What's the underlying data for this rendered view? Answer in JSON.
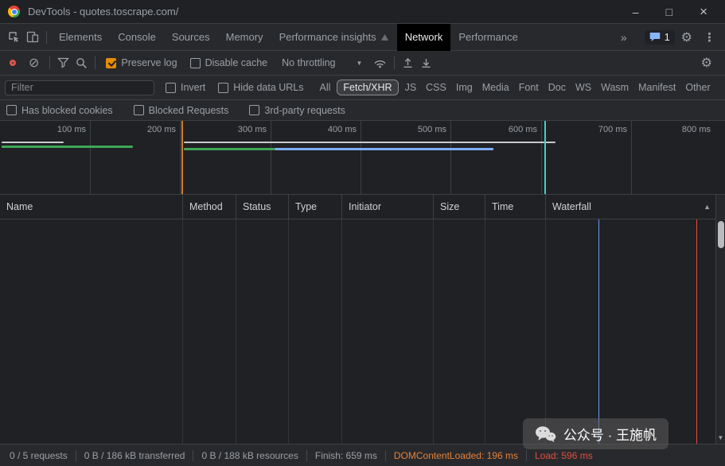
{
  "titlebar": {
    "title": "DevTools - quotes.toscrape.com/"
  },
  "icons": {
    "minimize": "–",
    "maximize": "□",
    "close": "×",
    "overflow": "»",
    "gear": "⚙",
    "more": "⋮",
    "clear": "⊘",
    "caret": "▼",
    "sort_asc": "▲",
    "scroll_down": "▼",
    "wechat": "wechat-bubbles"
  },
  "tabbar": {
    "tabs": [
      "Elements",
      "Console",
      "Sources",
      "Memory",
      "Performance insights",
      "Network",
      "Performance"
    ],
    "active_tab": "Network",
    "issues_count": "1"
  },
  "toolbar": {
    "preserve_log": "Preserve log",
    "disable_cache": "Disable cache",
    "throttling": "No throttling"
  },
  "filters": {
    "placeholder": "Filter",
    "invert": "Invert",
    "hide_data_urls": "Hide data URLs",
    "types": [
      "All",
      "Fetch/XHR",
      "JS",
      "CSS",
      "Img",
      "Media",
      "Font",
      "Doc",
      "WS",
      "Wasm",
      "Manifest",
      "Other"
    ],
    "selected_type": "Fetch/XHR",
    "row2": [
      "Has blocked cookies",
      "Blocked Requests",
      "3rd-party requests"
    ]
  },
  "overview": {
    "ticks": [
      "100 ms",
      "200 ms",
      "300 ms",
      "400 ms",
      "500 ms",
      "600 ms",
      "700 ms",
      "800 ms"
    ]
  },
  "table": {
    "columns": [
      "Name",
      "Method",
      "Status",
      "Type",
      "Initiator",
      "Size",
      "Time",
      "Waterfall"
    ]
  },
  "statusbar": {
    "requests": "0 / 5 requests",
    "transferred": "0 B / 186 kB transferred",
    "resources": "0 B / 188 kB resources",
    "finish": "Finish: 659 ms",
    "dcl": "DOMContentLoaded: 196 ms",
    "load": "Load: 596 ms"
  },
  "watermark": {
    "text": "公众号 · 王施帆"
  },
  "colors": {
    "accent_checkbox": "#e78b00",
    "dcl_orange": "#e5823a",
    "load_red": "#e0503f",
    "overview_green": "#3fa757",
    "overview_blue": "#7cacf8",
    "overview_teal": "#3fd0c9",
    "marker_blue": "#6b9bf5",
    "issues_blue": "#8ab4f8"
  }
}
